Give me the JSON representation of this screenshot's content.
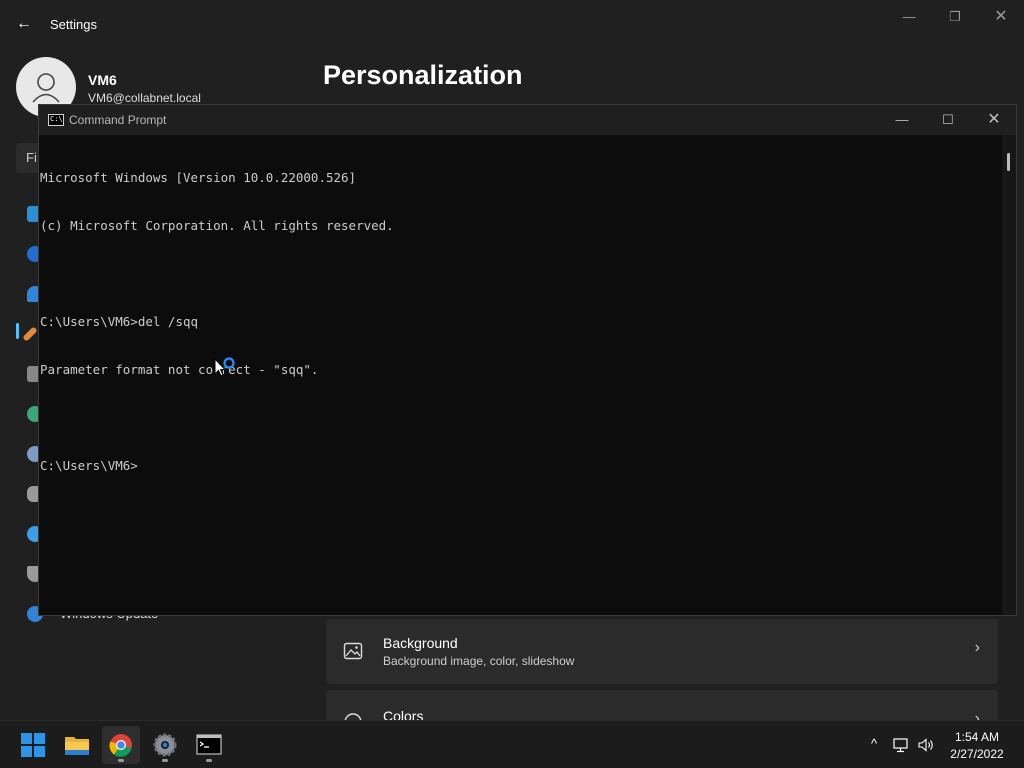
{
  "settings": {
    "title": "Settings",
    "back_glyph": "←",
    "minimize_glyph": "—",
    "maximize_glyph": "❐",
    "close_glyph": "✕",
    "user": {
      "name": "VM6",
      "email": "VM6@collabnet.local"
    },
    "page_title": "Personalization",
    "find_fragment": "Fi",
    "nav_visible_label": "Windows Update",
    "cards": [
      {
        "title": "Background",
        "subtitle": "Background image, color, slideshow",
        "icon": "image-icon"
      },
      {
        "title": "Colors",
        "subtitle": "",
        "icon": "palette-icon"
      }
    ],
    "chevron_glyph": "›",
    "accent": "#4cc2ff"
  },
  "cmd": {
    "title": "Command Prompt",
    "icon_text": "C:\\",
    "minimize_glyph": "—",
    "maximize_glyph": "☐",
    "close_glyph": "✕",
    "lines": [
      "Microsoft Windows [Version 10.0.22000.526]",
      "(c) Microsoft Corporation. All rights reserved.",
      "",
      "C:\\Users\\VM6>del /sqq",
      "Parameter format not correct - \"sqq\".",
      "",
      "C:\\Users\\VM6>"
    ]
  },
  "taskbar": {
    "apps": [
      "start-icon",
      "file-explorer-icon",
      "chrome-icon",
      "settings-icon",
      "terminal-icon"
    ],
    "tray": {
      "chevron": "^",
      "network": "🖧",
      "volume": "🔊"
    },
    "time": "1:54 AM",
    "date": "2/27/2022"
  }
}
